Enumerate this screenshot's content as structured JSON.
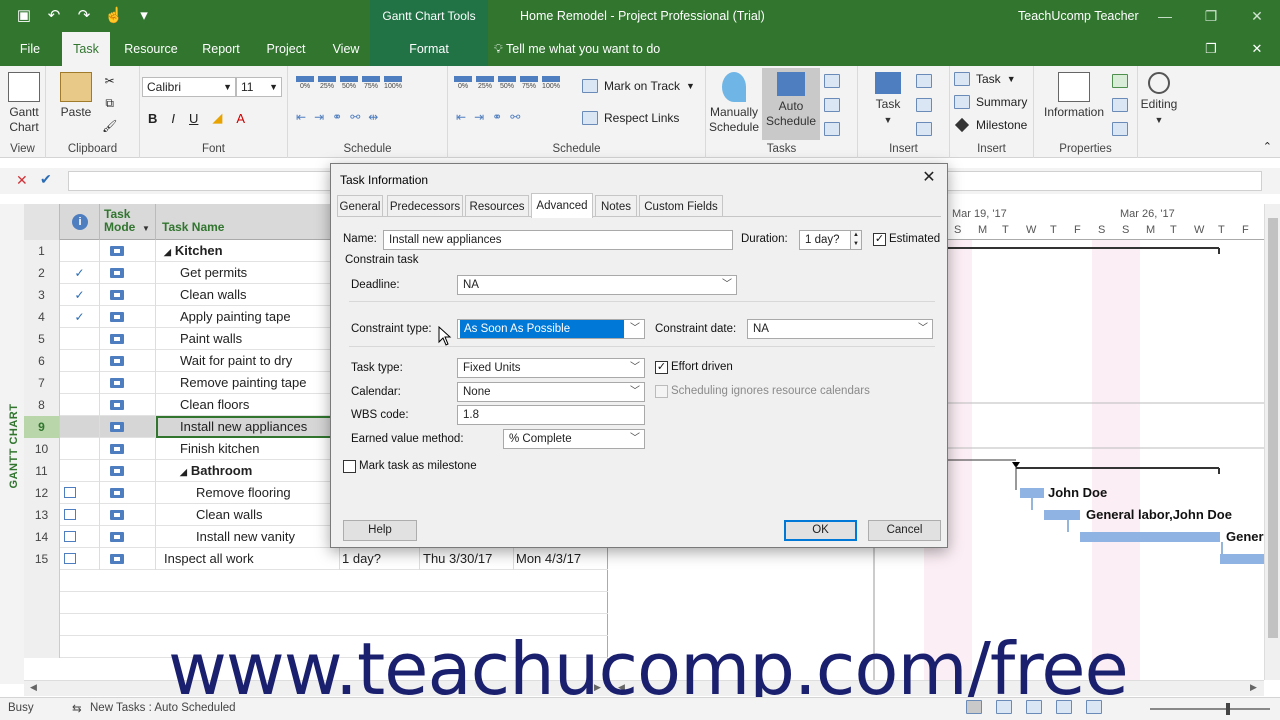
{
  "window": {
    "context_tab_group": "Gantt Chart Tools",
    "title": "Home Remodel  -  Project Professional (Trial)",
    "user": "TeachUcomp Teacher"
  },
  "tabs": [
    "File",
    "Task",
    "Resource",
    "Report",
    "Project",
    "View",
    "Format"
  ],
  "tell_me": "Tell me what you want to do",
  "ribbon": {
    "groups": {
      "view": "View",
      "clipboard": "Clipboard",
      "font": "Font",
      "schedule1": "Schedule",
      "schedule2": "Schedule",
      "tasks": "Tasks",
      "insert1": "Insert",
      "insert2": "Insert",
      "properties": "Properties"
    },
    "gantt_chart": "Gantt\nChart",
    "paste": "Paste",
    "font_name": "Calibri",
    "font_size": "11",
    "bold": "B",
    "italic": "I",
    "underline": "U",
    "pct": [
      "0%",
      "25%",
      "50%",
      "75%",
      "100%"
    ],
    "mark_on_track": "Mark on Track",
    "respect_links": "Respect Links",
    "manually_schedule": "Manually\nSchedule",
    "auto_schedule": "Auto\nSchedule",
    "task_btn": "Task",
    "task_menu": "Task",
    "summary": "Summary",
    "milestone": "Milestone",
    "information": "Information",
    "editing": "Editing"
  },
  "side_label": "GANTT CHART",
  "grid": {
    "headers": {
      "task_mode": "Task\nMode",
      "task_name": "Task Name"
    },
    "rows": [
      {
        "num": "1",
        "ind": "",
        "name": "Kitchen",
        "level": 0,
        "summary": true,
        "dur": "",
        "start": "",
        "finish": ""
      },
      {
        "num": "2",
        "ind": "✓",
        "name": "Get permits",
        "level": 1,
        "summary": false,
        "dur": "",
        "start": "",
        "finish": ""
      },
      {
        "num": "3",
        "ind": "✓",
        "name": "Clean walls",
        "level": 1,
        "summary": false,
        "dur": "",
        "start": "",
        "finish": ""
      },
      {
        "num": "4",
        "ind": "✓",
        "name": "Apply painting tape",
        "level": 1,
        "summary": false,
        "dur": "",
        "start": "",
        "finish": ""
      },
      {
        "num": "5",
        "ind": "",
        "name": "Paint walls",
        "level": 1,
        "summary": false,
        "dur": "",
        "start": "",
        "finish": ""
      },
      {
        "num": "6",
        "ind": "",
        "name": "Wait for paint to dry",
        "level": 1,
        "summary": false,
        "dur": "",
        "start": "",
        "finish": ""
      },
      {
        "num": "7",
        "ind": "",
        "name": "Remove painting tape",
        "level": 1,
        "summary": false,
        "dur": "",
        "start": "",
        "finish": ""
      },
      {
        "num": "8",
        "ind": "",
        "name": "Clean floors",
        "level": 1,
        "summary": false,
        "dur": "",
        "start": "",
        "finish": ""
      },
      {
        "num": "9",
        "ind": "",
        "name": "Install new appliances",
        "level": 1,
        "summary": false,
        "dur": "",
        "start": "",
        "finish": ""
      },
      {
        "num": "10",
        "ind": "",
        "name": "Finish kitchen",
        "level": 1,
        "summary": false,
        "dur": "",
        "start": "",
        "finish": ""
      },
      {
        "num": "11",
        "ind": "",
        "name": "Bathroom",
        "level": 1,
        "summary": true,
        "dur": "",
        "start": "",
        "finish": ""
      },
      {
        "num": "12",
        "ind": "cal",
        "name": "Remove flooring",
        "level": 2,
        "summary": false,
        "dur": "",
        "start": "",
        "finish": ""
      },
      {
        "num": "13",
        "ind": "cal",
        "name": "Clean walls",
        "level": 2,
        "summary": false,
        "dur": "",
        "start": "",
        "finish": ""
      },
      {
        "num": "14",
        "ind": "cal",
        "name": "Install new vanity",
        "level": 2,
        "summary": false,
        "dur": "",
        "start": "",
        "finish": ""
      },
      {
        "num": "15",
        "ind": "cal",
        "name": "Inspect all work",
        "level": 0,
        "summary": false,
        "dur": "1 day?",
        "start": "Thu 3/30/17",
        "finish": "Mon 4/3/17"
      }
    ]
  },
  "chart": {
    "weeks": [
      "Mar 19, '17",
      "Mar 26, '17"
    ],
    "days": [
      "S",
      "M",
      "T",
      "W",
      "T",
      "F",
      "S",
      "S",
      "M",
      "T",
      "W",
      "T",
      "F"
    ],
    "bar_labels": [
      "John Doe",
      "General labor,John Doe",
      "Gener"
    ]
  },
  "dialog": {
    "title": "Task Information",
    "close": "✕",
    "tabs": [
      "General",
      "Predecessors",
      "Resources",
      "Advanced",
      "Notes",
      "Custom Fields"
    ],
    "active_tab": "Advanced",
    "name_label": "Name:",
    "name_value": "Install new appliances",
    "duration_label": "Duration:",
    "duration_value": "1 day?",
    "estimated_label": "Estimated",
    "estimated_checked": true,
    "constrain_task": "Constrain task",
    "deadline_label": "Deadline:",
    "deadline_value": "NA",
    "constraint_type_label": "Constraint type:",
    "constraint_type_value": "As Soon As Possible",
    "constraint_date_label": "Constraint date:",
    "constraint_date_value": "NA",
    "task_type_label": "Task type:",
    "task_type_value": "Fixed Units",
    "effort_driven_label": "Effort driven",
    "effort_driven_checked": true,
    "calendar_label": "Calendar:",
    "calendar_value": "None",
    "sched_ignores_label": "Scheduling ignores resource calendars",
    "wbs_label": "WBS code:",
    "wbs_value": "1.8",
    "evm_label": "Earned value method:",
    "evm_value": "% Complete",
    "milestone_label": "Mark task as milestone",
    "help": "Help",
    "ok": "OK",
    "cancel": "Cancel"
  },
  "watermark": "www.teachucomp.com/free",
  "status": {
    "mode": "Busy",
    "new_tasks": "New Tasks : Auto Scheduled"
  },
  "colors": {
    "title_green": "#31752f",
    "bar_blue": "#8fb4e3",
    "watermark": "#1a1f6e"
  }
}
